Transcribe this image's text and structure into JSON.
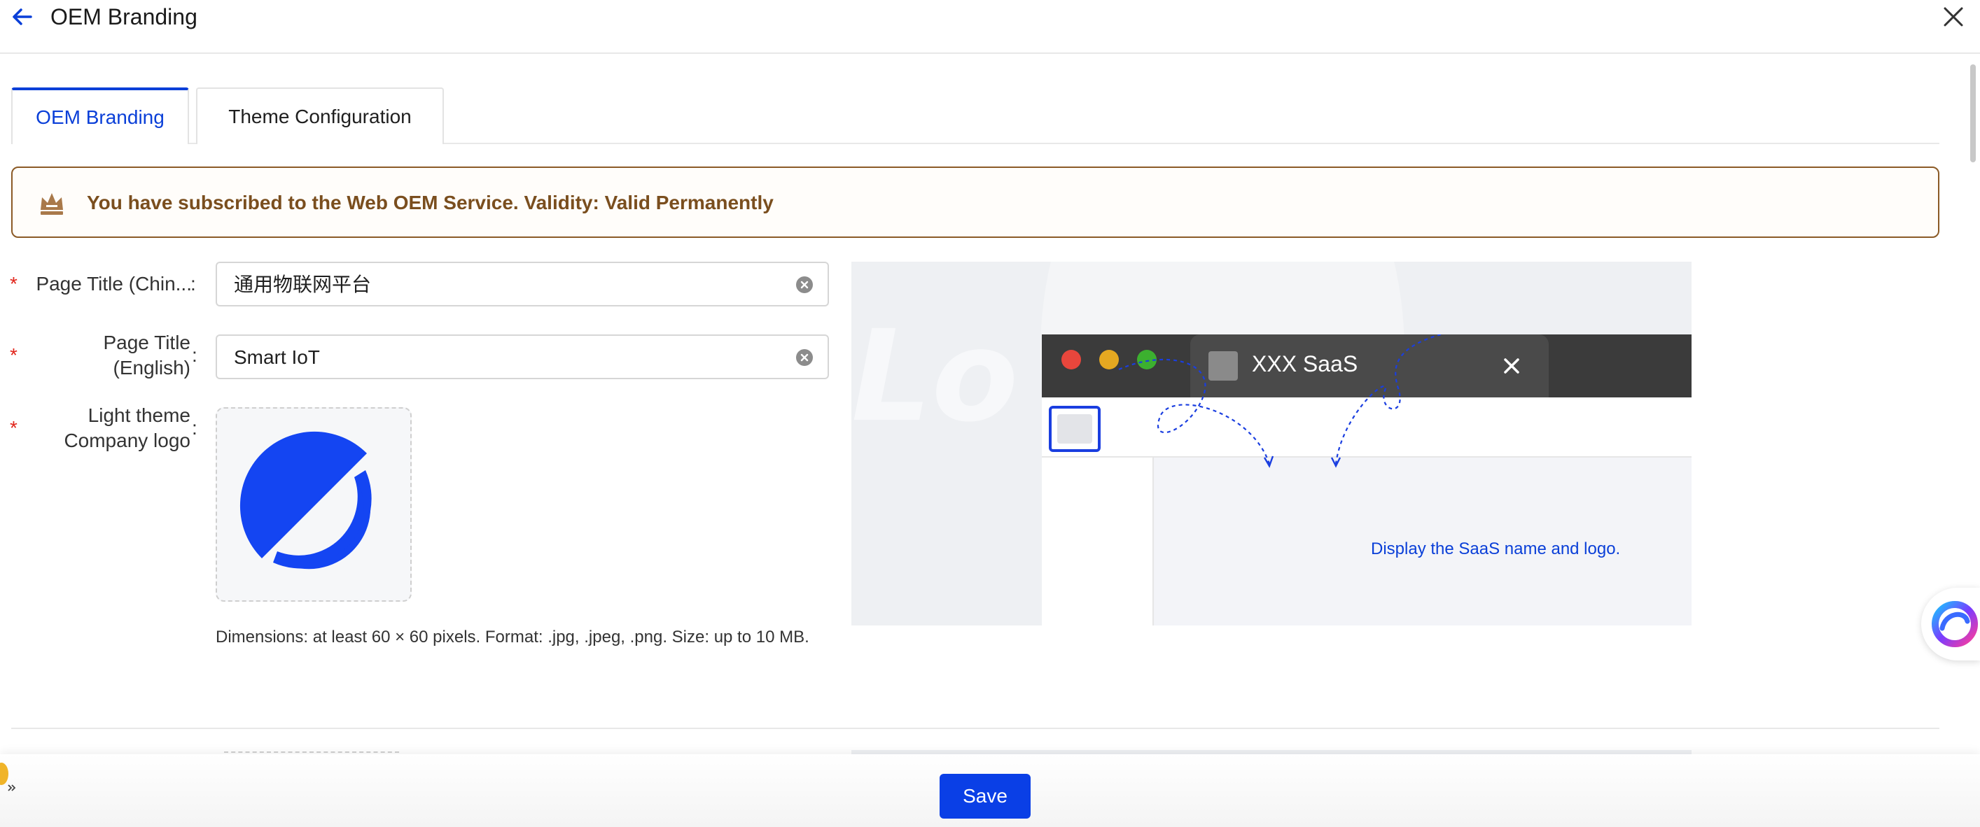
{
  "header": {
    "title": "OEM Branding",
    "back_icon": "arrow-left-icon",
    "close_icon": "close-icon"
  },
  "tabs": [
    {
      "label": "OEM Branding",
      "active": true
    },
    {
      "label": "Theme Configuration",
      "active": false
    }
  ],
  "notice": {
    "icon": "crown-icon",
    "text": "You have subscribed to the Web OEM Service. Validity: Valid Permanently"
  },
  "form": {
    "title_cn": {
      "label": "Page Title (Chin...",
      "value": "通用物联网平台",
      "required": true
    },
    "title_en": {
      "label_line1": "Page Title",
      "label_line2": "(English)",
      "value": "Smart IoT",
      "required": true
    },
    "logo": {
      "label_line1": "Light theme",
      "label_line2": "Company logo",
      "required": true
    },
    "colon": ":",
    "required_mark": "*",
    "hint": "Dimensions: at least 60 × 60 pixels. Format: .jpg, .jpeg, .png. Size: up to 10 MB."
  },
  "preview": {
    "watermark": "Lo",
    "tab_title": "XXX SaaS",
    "caption": "Display the SaaS name and logo."
  },
  "footer": {
    "save_label": "Save"
  },
  "colors": {
    "primary": "#0a3fe6",
    "notice_border": "#8b5a26",
    "notice_text": "#7a4e1e",
    "required": "#e1251b",
    "logo_blue": "#1445f2"
  }
}
